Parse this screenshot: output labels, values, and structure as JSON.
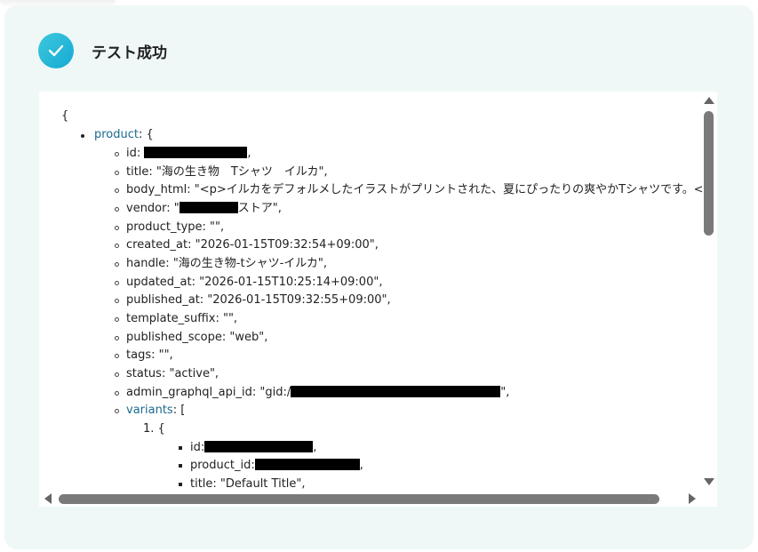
{
  "header": {
    "title": "テスト成功",
    "icon": "check-icon",
    "accent_color": "#22b4d8"
  },
  "json": {
    "open_brace": "{",
    "product_key": "product",
    "product_suffix": ": {",
    "id_prefix": "id: ",
    "id_suffix": ",",
    "title": "title: \"海の生き物　Tシャツ　イルカ\",",
    "body_html": "body_html: \"<p>イルカをデフォルメしたイラストがプリントされた、夏にぴったりの爽やかTシャツです。</p",
    "vendor_prefix": "vendor: \"",
    "vendor_suffix": "ストア\",",
    "product_type": "product_type: \"\",",
    "created_at": "created_at: \"2026-01-15T09:32:54+09:00\",",
    "handle": "handle: \"海の生き物-tシャツ-イルカ\",",
    "updated_at": "updated_at: \"2026-01-15T10:25:14+09:00\",",
    "published_at": "published_at: \"2026-01-15T09:32:55+09:00\",",
    "template_suffix": "template_suffix: \"\",",
    "published_scope": "published_scope: \"web\",",
    "tags": "tags: \"\",",
    "status": "status: \"active\",",
    "admin_prefix": "admin_graphql_api_id: \"gid:/",
    "admin_suffix": "\",",
    "variants_key": "variants",
    "variants_suffix": ": [",
    "item_number": "1.",
    "item_brace": "{",
    "variant_id_prefix": "id:",
    "variant_id_suffix": ",",
    "variant_product_id_prefix": "product_id:",
    "variant_product_id_suffix": ",",
    "variant_title": "title: \"Default Title\","
  }
}
